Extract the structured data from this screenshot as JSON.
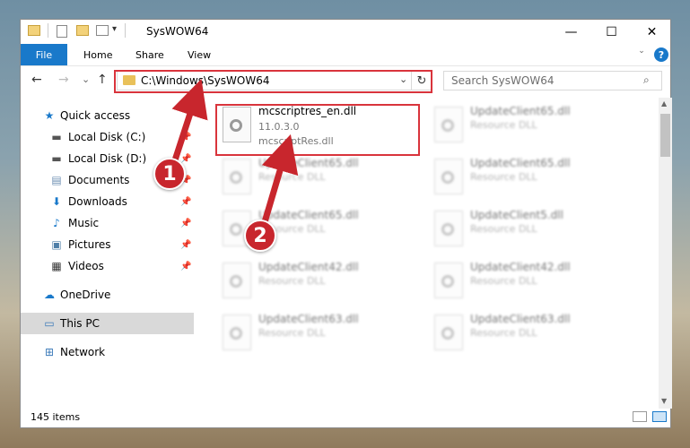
{
  "window": {
    "title": "SysWOW64",
    "minimize": "—",
    "maximize": "☐",
    "close": "✕"
  },
  "ribbon": {
    "file": "File",
    "home": "Home",
    "share": "Share",
    "view": "View",
    "help": "?"
  },
  "nav": {
    "back": "←",
    "forward": "→",
    "recent": "⌄",
    "up": "↑",
    "address": "C:\\Windows\\SysWOW64",
    "refresh": "↻",
    "search_placeholder": "Search SysWOW64"
  },
  "sidebar": {
    "items": [
      {
        "label": "Quick access",
        "icon": "star-icon"
      },
      {
        "label": "Local Disk (C:)",
        "icon": "drive-icon"
      },
      {
        "label": "Local Disk (D:)",
        "icon": "drive-icon"
      },
      {
        "label": "Documents",
        "icon": "documents-icon"
      },
      {
        "label": "Downloads",
        "icon": "download-icon"
      },
      {
        "label": "Music",
        "icon": "music-icon"
      },
      {
        "label": "Pictures",
        "icon": "pictures-icon"
      },
      {
        "label": "Videos",
        "icon": "videos-icon"
      },
      {
        "label": "OneDrive",
        "icon": "cloud-icon"
      },
      {
        "label": "This PC",
        "icon": "pc-icon"
      },
      {
        "label": "Network",
        "icon": "network-icon"
      }
    ]
  },
  "files": [
    {
      "name": "mcscriptres_en.dll",
      "version": "11.0.3.0",
      "desc": "mcscriptRes.dll"
    },
    {
      "name": "UpdateClient65.dll",
      "version": "",
      "desc": "Resource DLL"
    },
    {
      "name": "UpdateClient65.dll",
      "version": "",
      "desc": "Resource DLL"
    },
    {
      "name": "UpdateClient65.dll",
      "version": "",
      "desc": "Resource DLL"
    },
    {
      "name": "UpdateClient65.dll",
      "version": "",
      "desc": "Resource DLL"
    },
    {
      "name": "UpdateClient5.dll",
      "version": "",
      "desc": "Resource DLL"
    },
    {
      "name": "UpdateClient42.dll",
      "version": "",
      "desc": "Resource DLL"
    },
    {
      "name": "UpdateClient42.dll",
      "version": "",
      "desc": "Resource DLL"
    },
    {
      "name": "UpdateClient63.dll",
      "version": "",
      "desc": "Resource DLL"
    },
    {
      "name": "UpdateClient63.dll",
      "version": "",
      "desc": "Resource DLL"
    }
  ],
  "status": {
    "count": "145 items"
  },
  "annotations": {
    "step1": "1",
    "step2": "2"
  },
  "colors": {
    "accent": "#1979ca",
    "highlight": "#d9343c"
  }
}
